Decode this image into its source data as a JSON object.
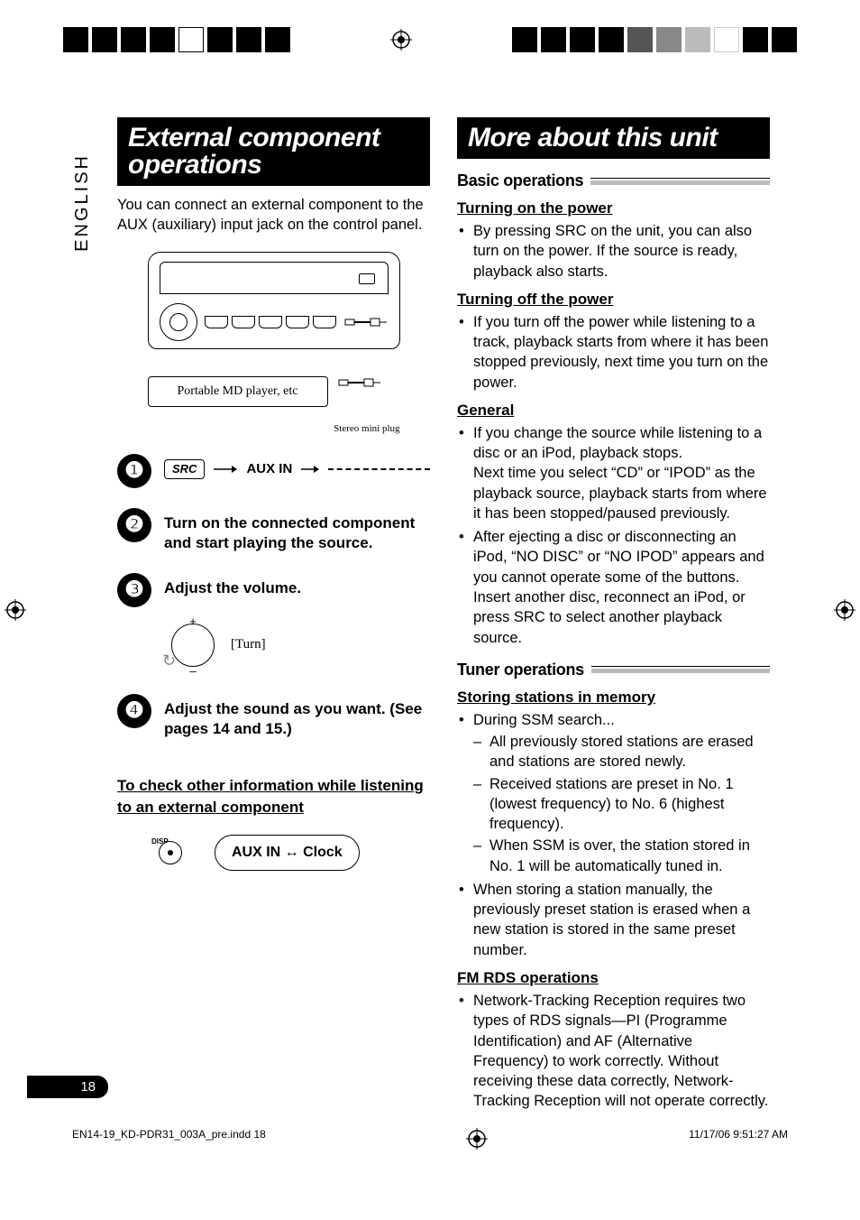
{
  "lang_label": "ENGLISH",
  "page_number": "18",
  "footer": {
    "file": "EN14-19_KD-PDR31_003A_pre.indd   18",
    "timestamp": "11/17/06   9:51:27 AM"
  },
  "left": {
    "heading": "External component operations",
    "intro": "You can connect an external component to the AUX (auxiliary) input jack on the control panel.",
    "diagram": {
      "device_label": "Portable MD player, etc",
      "plug_label": "Stereo mini plug"
    },
    "steps": [
      {
        "num": "❶",
        "src_label": "SRC",
        "aux_label": "AUX IN"
      },
      {
        "num": "❷",
        "text": "Turn on the connected component and start playing the source."
      },
      {
        "num": "❸",
        "text": "Adjust the volume.",
        "turn_label": "[Turn]"
      },
      {
        "num": "❹",
        "text": "Adjust the sound as you want. (See pages 14 and 15.)"
      }
    ],
    "check_heading": "To check other information while listening to an external component",
    "disp_label": "DISP",
    "clock_text": "AUX IN ↔ Clock"
  },
  "right": {
    "heading": "More about this unit",
    "basic_ops": {
      "title": "Basic operations",
      "turn_on": {
        "heading": "Turning on the power",
        "bullets": [
          "By pressing SRC on the unit, you can also turn on the power. If the source is ready, playback also starts."
        ]
      },
      "turn_off": {
        "heading": "Turning off the power",
        "bullets": [
          "If you turn off the power while listening to a track, playback starts from where it has been stopped previously, next time you turn on the power."
        ]
      },
      "general": {
        "heading": "General",
        "bullets": [
          "If you change the source while listening to a disc or an iPod, playback stops.\nNext time you select “CD” or “IPOD” as the playback source, playback starts from where it has been stopped/paused previously.",
          "After ejecting a disc or disconnecting an iPod, “NO DISC” or “NO IPOD” appears and you cannot operate some of the buttons. Insert another disc, reconnect an iPod, or press SRC to select another playback source."
        ]
      }
    },
    "tuner_ops": {
      "title": "Tuner operations",
      "storing": {
        "heading": "Storing stations in memory",
        "bullet1": "During SSM search...",
        "dashes": [
          "All previously stored stations are erased and stations are stored newly.",
          "Received stations are preset in No. 1 (lowest frequency) to No. 6 (highest frequency).",
          "When SSM is over, the station stored in No. 1 will be automatically tuned in."
        ],
        "bullet2": "When storing a station manually, the previously preset station is erased when a new station is stored in the same preset number."
      },
      "rds": {
        "heading": "FM RDS operations",
        "bullets": [
          "Network-Tracking Reception requires two types of RDS signals—PI (Programme Identification) and AF (Alternative Frequency) to work correctly. Without receiving these data correctly, Network-Tracking Reception will not operate correctly."
        ]
      }
    }
  }
}
